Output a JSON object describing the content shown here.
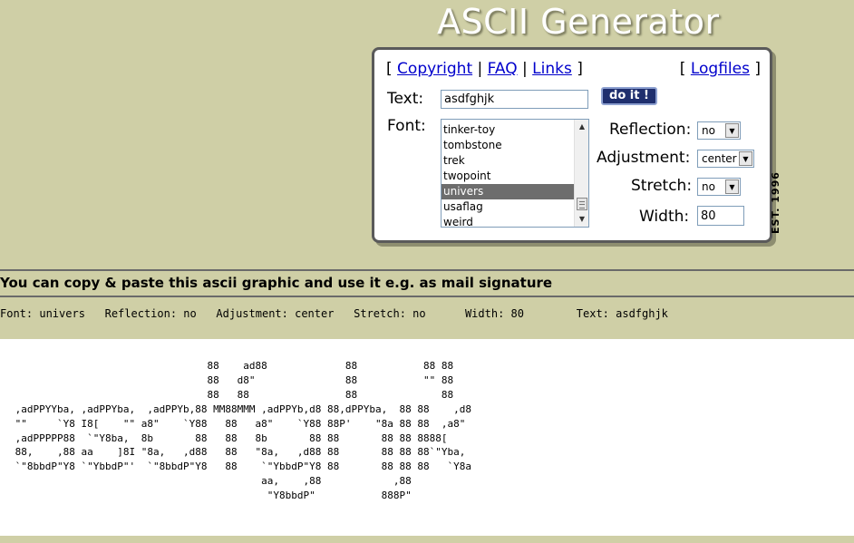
{
  "header": {
    "logo_text": "ASCII Generator"
  },
  "nav": {
    "links": [
      "Copyright",
      "FAQ",
      "Links"
    ],
    "logfiles": "Logfiles"
  },
  "form": {
    "text_label": "Text:",
    "text_value": "asdfghjk",
    "do_it_label": "do it !",
    "font_label": "Font:",
    "font_options": [
      "tinker-toy",
      "tombstone",
      "trek",
      "twopoint",
      "univers",
      "usaflag",
      "weird"
    ],
    "font_selected": "univers",
    "reflection_label": "Reflection:",
    "reflection_value": "no",
    "adjustment_label": "Adjustment:",
    "adjustment_value": "center",
    "stretch_label": "Stretch:",
    "stretch_value": "no",
    "width_label": "Width:",
    "width_value": "80"
  },
  "badge": {
    "est": "EST. 1996"
  },
  "result": {
    "heading": "You can copy & paste this ascii graphic and use it e.g. as mail signature",
    "settings_line": "Font: univers   Reflection: no   Adjustment: center   Stretch: no      Width: 80        Text: asdfghjk",
    "ascii_art": "                                 88    ad88             88           88 88\n                                 88   d8\"               88           \"\" 88\n                                 88   88                88              88\n ,adPPYYba, ,adPPYba,  ,adPPYb,88 MM88MMM ,adPPYb,d8 88,dPPYba,  88 88    ,d8\n \"\"     `Y8 I8[    \"\" a8\"    `Y88   88   a8\"    `Y88 88P'    \"8a 88 88  ,a8\"\n ,adPPPPP88  `\"Y8ba,  8b       88   88   8b       88 88       88 88 8888[\n 88,    ,88 aa    ]8I \"8a,   ,d88   88   \"8a,   ,d88 88       88 88 88`\"Yba,\n `\"8bbdP\"Y8 `\"YbbdP\"'  `\"8bbdP\"Y8   88    `\"YbbdP\"Y8 88       88 88 88   `Y8a\n                                          aa,    ,88            ,88\n                                           \"Y8bbdP\"           888P\""
  },
  "colors": {
    "page_background": "#cfcfa6",
    "link": "#0000cc",
    "button": "#1f2f6e",
    "list_selection": "#6d6d6d"
  }
}
